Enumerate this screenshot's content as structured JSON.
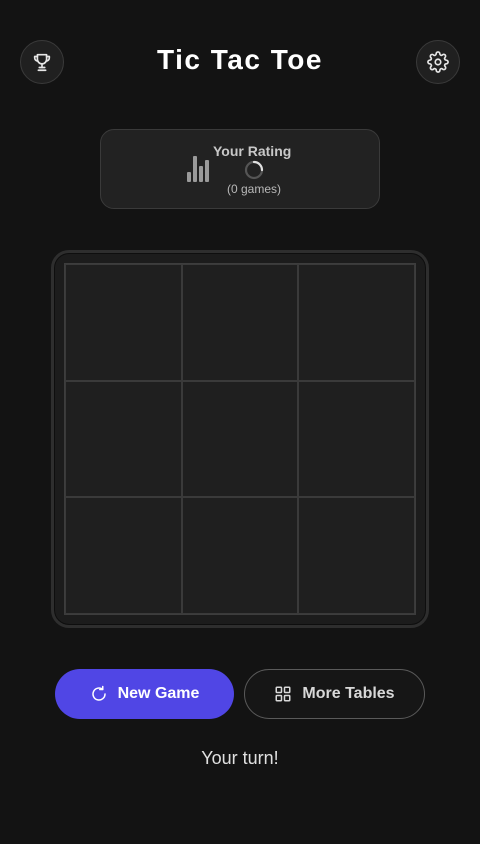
{
  "header": {
    "title": "Tic Tac Toe",
    "left_icon": "trophy-icon",
    "right_icon": "gear-icon"
  },
  "rating": {
    "label": "Your Rating",
    "games": "(0 games)",
    "icon": "bar-chart-icon",
    "loading": true
  },
  "board": {
    "cells": [
      "",
      "",
      "",
      "",
      "",
      "",
      "",
      "",
      ""
    ]
  },
  "actions": {
    "new_game": "New Game",
    "new_game_icon": "refresh-icon",
    "more_tables": "More Tables",
    "more_tables_icon": "grid-icon"
  },
  "status": "Your turn!",
  "colors": {
    "background": "#131313",
    "accent": "#5046e5",
    "card": "#222222"
  }
}
